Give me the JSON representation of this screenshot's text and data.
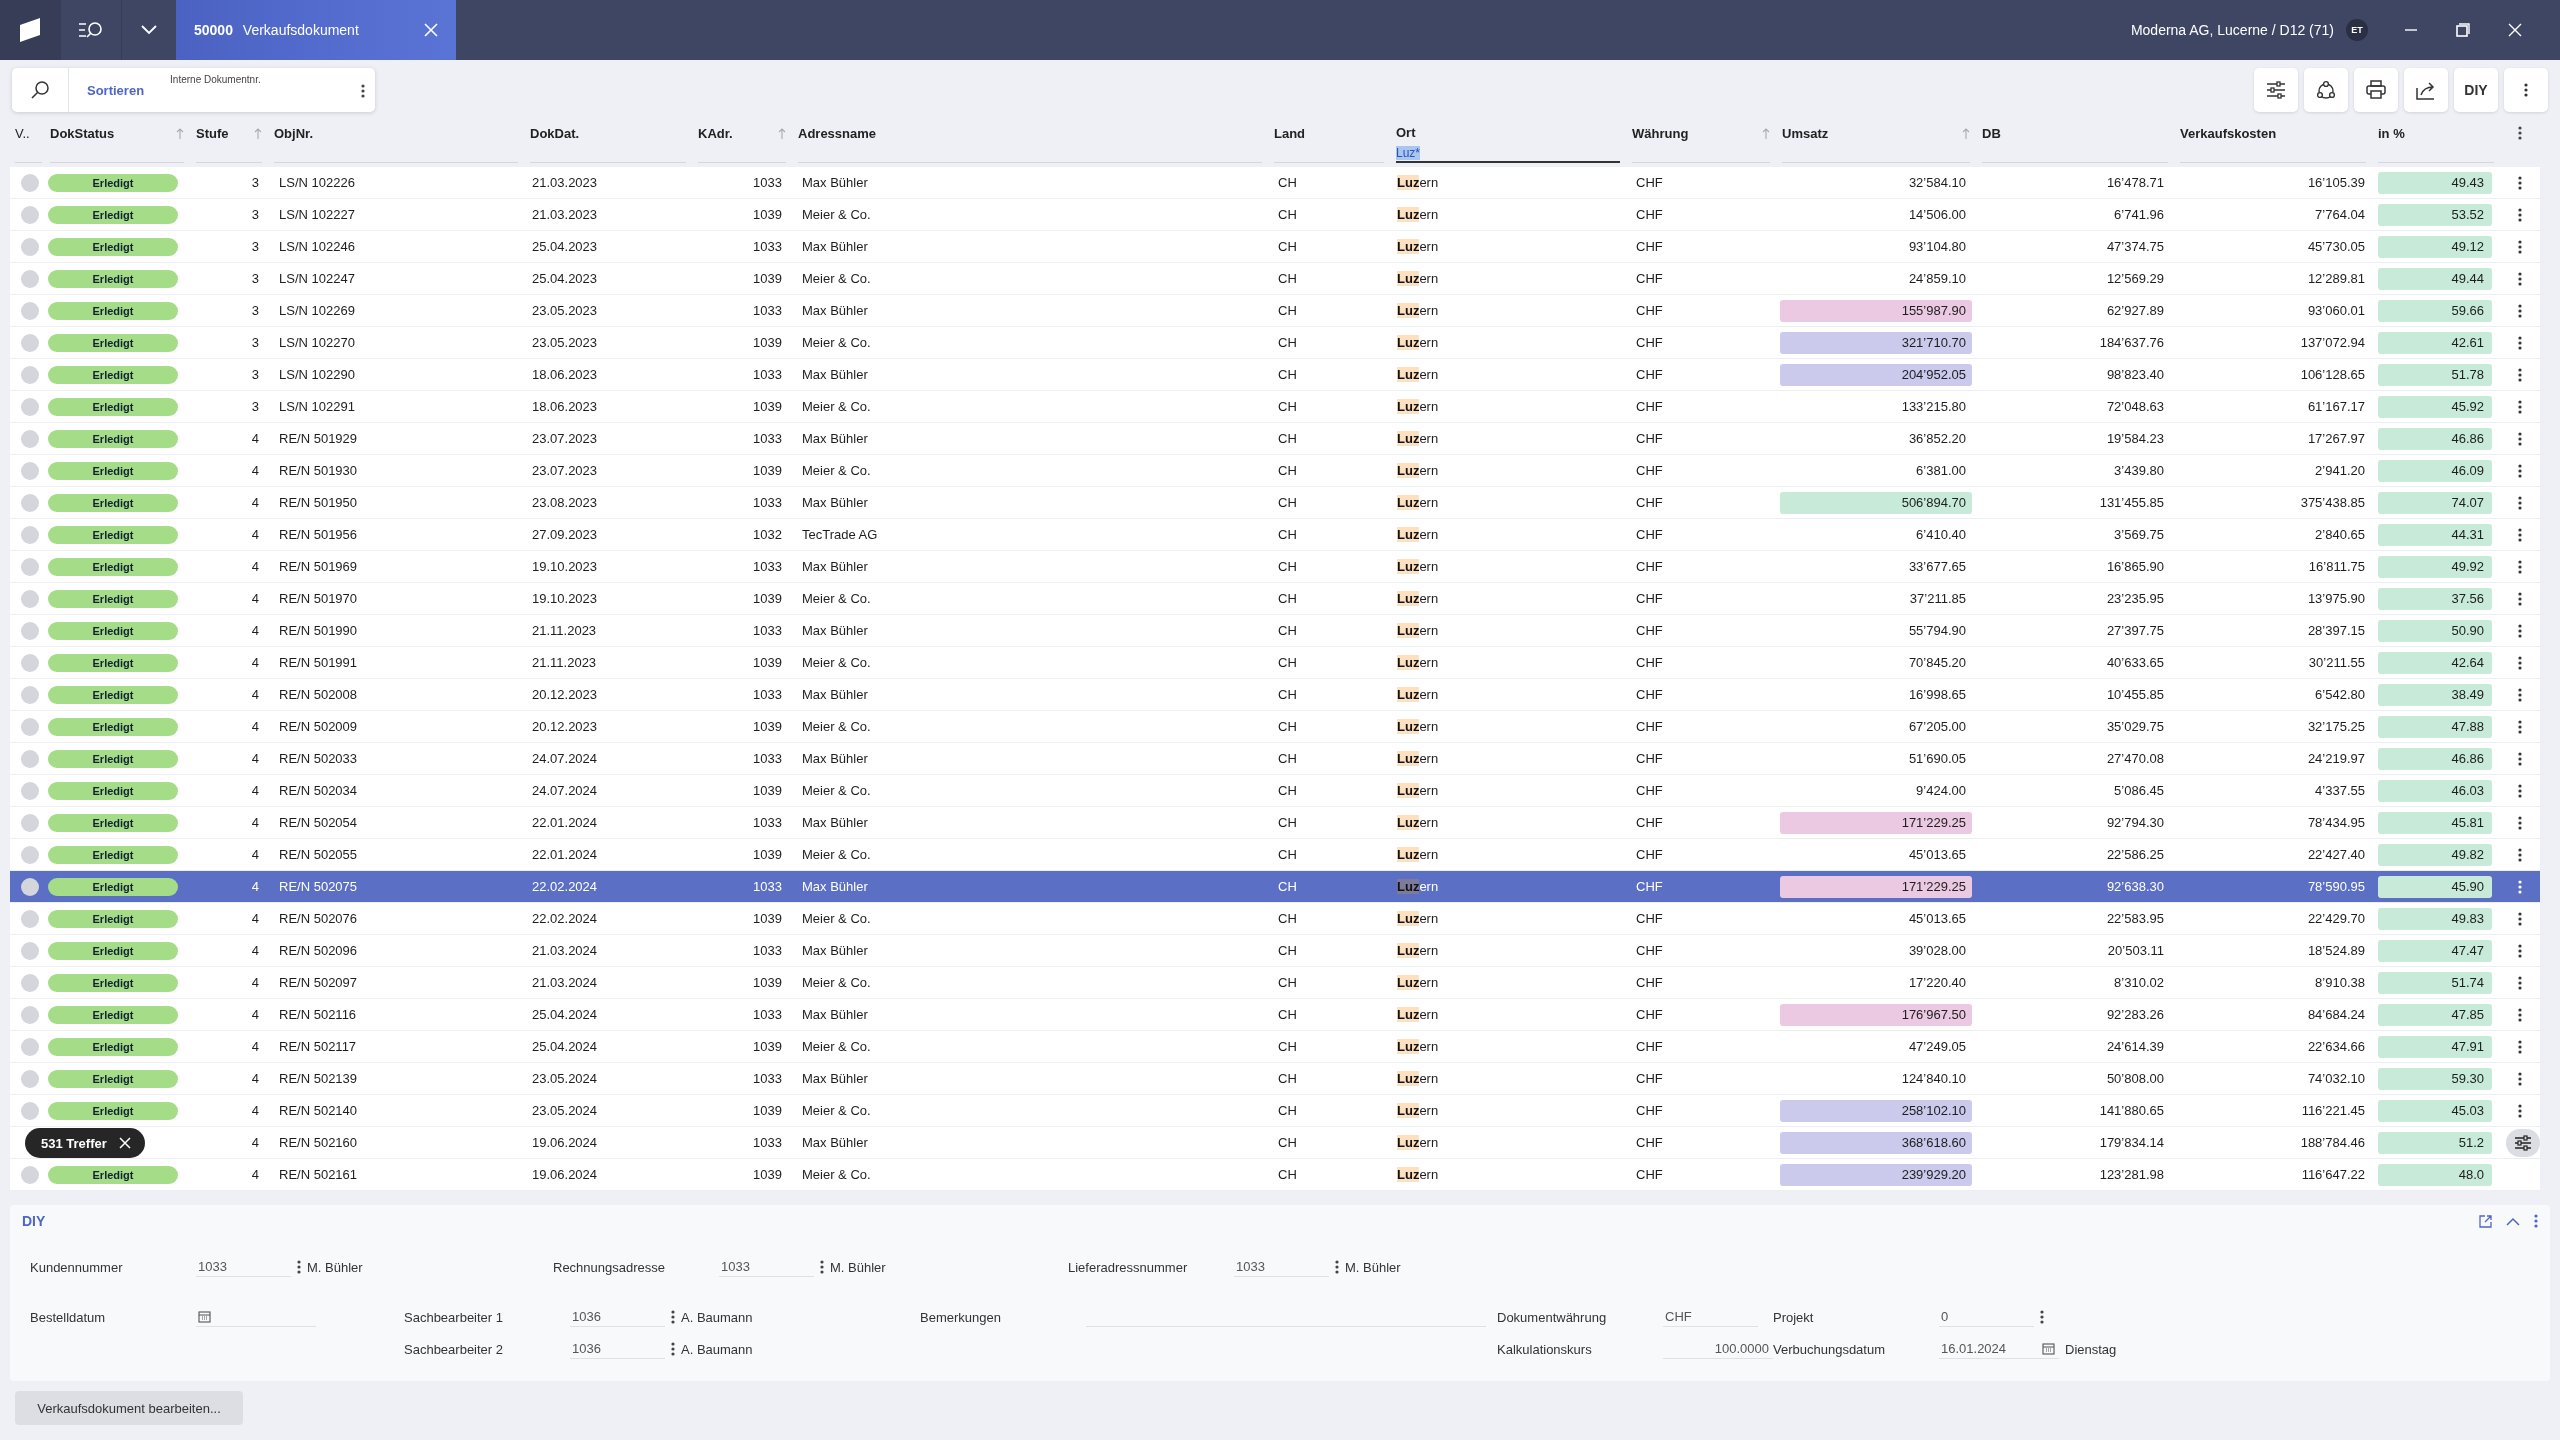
{
  "titlebar": {
    "tab": {
      "number": "50000",
      "title": "Verkaufsdokument",
      "selected": true
    },
    "company": "Moderna AG, Lucerne / D12 (71)",
    "avatar": "ET"
  },
  "search_card": {
    "sort_label": "Sortieren",
    "field_label": "Interne Dokumentnr."
  },
  "toolbar": {
    "diy_label": "DIY"
  },
  "table": {
    "columns": [
      {
        "label": "V..",
        "sortable": false
      },
      {
        "label": "DokStatus",
        "sortable": true
      },
      {
        "label": "Stufe",
        "sortable": true
      },
      {
        "label": "ObjNr.",
        "sortable": false
      },
      {
        "label": "DokDat.",
        "sortable": false
      },
      {
        "label": "KAdr.",
        "sortable": true
      },
      {
        "label": "Adressname",
        "sortable": false
      },
      {
        "label": "Land",
        "sortable": false
      },
      {
        "label": "Ort",
        "sortable": false,
        "filter": "Luz*"
      },
      {
        "label": "Währung",
        "sortable": true
      },
      {
        "label": "Umsatz",
        "sortable": true
      },
      {
        "label": "DB",
        "sortable": false
      },
      {
        "label": "Verkaufskosten",
        "sortable": false
      },
      {
        "label": "in %",
        "sortable": false
      }
    ],
    "rows": [
      {
        "status": "Erledigt",
        "stufe": "3",
        "objnr": "LS/N 102226",
        "dokdat": "21.03.2023",
        "kadr": "1033",
        "adressname": "Max Bühler",
        "land": "CH",
        "ort": "**Luz**ern",
        "waehrung": "CHF",
        "umsatz": "32’584.10",
        "db": "16’478.71",
        "verkaufskosten": "16’105.39",
        "in_pct": "49.43",
        "selected": false
      },
      {
        "status": "Erledigt",
        "stufe": "3",
        "objnr": "LS/N 102227",
        "dokdat": "21.03.2023",
        "kadr": "1039",
        "adressname": "Meier & Co.",
        "land": "CH",
        "ort": "**Luz**ern",
        "waehrung": "CHF",
        "umsatz": "14’506.00",
        "db": "6’741.96",
        "verkaufskosten": "7’764.04",
        "in_pct": "53.52",
        "selected": false
      },
      {
        "status": "Erledigt",
        "stufe": "3",
        "objnr": "LS/N 102246",
        "dokdat": "25.04.2023",
        "kadr": "1033",
        "adressname": "Max Bühler",
        "land": "CH",
        "ort": "**Luz**ern",
        "waehrung": "CHF",
        "umsatz": "93’104.80",
        "db": "47’374.75",
        "verkaufskosten": "45’730.05",
        "in_pct": "49.12",
        "selected": false
      },
      {
        "status": "Erledigt",
        "stufe": "3",
        "objnr": "LS/N 102247",
        "dokdat": "25.04.2023",
        "kadr": "1039",
        "adressname": "Meier & Co.",
        "land": "CH",
        "ort": "**Luz**ern",
        "waehrung": "CHF",
        "umsatz": "24’859.10",
        "db": "12’569.29",
        "verkaufskosten": "12’289.81",
        "in_pct": "49.44",
        "selected": false
      },
      {
        "status": "Erledigt",
        "stufe": "3",
        "objnr": "LS/N 102269",
        "dokdat": "23.05.2023",
        "kadr": "1033",
        "adressname": "Max Bühler",
        "land": "CH",
        "ort": "**Luz**ern",
        "waehrung": "CHF",
        "umsatz": "155’987.90",
        "color": "#ecc9e2",
        "db": "62’927.89",
        "verkaufskosten": "93’060.01",
        "in_pct": "59.66",
        "selected": false
      },
      {
        "status": "Erledigt",
        "stufe": "3",
        "objnr": "LS/N 102270",
        "dokdat": "23.05.2023",
        "kadr": "1039",
        "adressname": "Meier & Co.",
        "land": "CH",
        "ort": "**Luz**ern",
        "waehrung": "CHF",
        "umsatz": "321’710.70",
        "color": "#cbc9ec",
        "db": "184’637.76",
        "verkaufskosten": "137’072.94",
        "in_pct": "42.61",
        "selected": false
      },
      {
        "status": "Erledigt",
        "stufe": "3",
        "objnr": "LS/N 102290",
        "dokdat": "18.06.2023",
        "kadr": "1033",
        "adressname": "Max Bühler",
        "land": "CH",
        "ort": "**Luz**ern",
        "waehrung": "CHF",
        "umsatz": "204’952.05",
        "color": "#cbc9ec",
        "db": "98’823.40",
        "verkaufskosten": "106’128.65",
        "in_pct": "51.78",
        "selected": false
      },
      {
        "status": "Erledigt",
        "stufe": "3",
        "objnr": "LS/N 102291",
        "dokdat": "18.06.2023",
        "kadr": "1039",
        "adressname": "Meier & Co.",
        "land": "CH",
        "ort": "**Luz**ern",
        "waehrung": "CHF",
        "umsatz": "133’215.80",
        "db": "72’048.63",
        "verkaufskosten": "61’167.17",
        "in_pct": "45.92",
        "selected": false
      },
      {
        "status": "Erledigt",
        "stufe": "4",
        "objnr": "RE/N 501929",
        "dokdat": "23.07.2023",
        "kadr": "1033",
        "adressname": "Max Bühler",
        "land": "CH",
        "ort": "**Luz**ern",
        "waehrung": "CHF",
        "umsatz": "36’852.20",
        "db": "19’584.23",
        "verkaufskosten": "17’267.97",
        "in_pct": "46.86",
        "selected": false
      },
      {
        "status": "Erledigt",
        "stufe": "4",
        "objnr": "RE/N 501930",
        "dokdat": "23.07.2023",
        "kadr": "1039",
        "adressname": "Meier & Co.",
        "land": "CH",
        "ort": "**Luz**ern",
        "waehrung": "CHF",
        "umsatz": "6’381.00",
        "db": "3’439.80",
        "verkaufskosten": "2’941.20",
        "in_pct": "46.09",
        "selected": false
      },
      {
        "status": "Erledigt",
        "stufe": "4",
        "objnr": "RE/N 501950",
        "dokdat": "23.08.2023",
        "kadr": "1033",
        "adressname": "Max Bühler",
        "land": "CH",
        "ort": "**Luz**ern",
        "waehrung": "CHF",
        "umsatz": "506’894.70",
        "color": "#c8ead8",
        "db": "131’455.85",
        "verkaufskosten": "375’438.85",
        "in_pct": "74.07",
        "selected": false
      },
      {
        "status": "Erledigt",
        "stufe": "4",
        "objnr": "RE/N 501956",
        "dokdat": "27.09.2023",
        "kadr": "1032",
        "adressname": "TecTrade AG",
        "land": "CH",
        "ort": "**Luz**ern",
        "waehrung": "CHF",
        "umsatz": "6’410.40",
        "db": "3’569.75",
        "verkaufskosten": "2’840.65",
        "in_pct": "44.31",
        "selected": false
      },
      {
        "status": "Erledigt",
        "stufe": "4",
        "objnr": "RE/N 501969",
        "dokdat": "19.10.2023",
        "kadr": "1033",
        "adressname": "Max Bühler",
        "land": "CH",
        "ort": "**Luz**ern",
        "waehrung": "CHF",
        "umsatz": "33’677.65",
        "db": "16’865.90",
        "verkaufskosten": "16’811.75",
        "in_pct": "49.92",
        "selected": false
      },
      {
        "status": "Erledigt",
        "stufe": "4",
        "objnr": "RE/N 501970",
        "dokdat": "19.10.2023",
        "kadr": "1039",
        "adressname": "Meier & Co.",
        "land": "CH",
        "ort": "**Luz**ern",
        "waehrung": "CHF",
        "umsatz": "37’211.85",
        "db": "23’235.95",
        "verkaufskosten": "13’975.90",
        "in_pct": "37.56",
        "selected": false
      },
      {
        "status": "Erledigt",
        "stufe": "4",
        "objnr": "RE/N 501990",
        "dokdat": "21.11.2023",
        "kadr": "1033",
        "adressname": "Max Bühler",
        "land": "CH",
        "ort": "**Luz**ern",
        "waehrung": "CHF",
        "umsatz": "55’794.90",
        "db": "27’397.75",
        "verkaufskosten": "28’397.15",
        "in_pct": "50.90",
        "selected": false
      },
      {
        "status": "Erledigt",
        "stufe": "4",
        "objnr": "RE/N 501991",
        "dokdat": "21.11.2023",
        "kadr": "1039",
        "adressname": "Meier & Co.",
        "land": "CH",
        "ort": "**Luz**ern",
        "waehrung": "CHF",
        "umsatz": "70’845.20",
        "db": "40’633.65",
        "verkaufskosten": "30’211.55",
        "in_pct": "42.64",
        "selected": false
      },
      {
        "status": "Erledigt",
        "stufe": "4",
        "objnr": "RE/N 502008",
        "dokdat": "20.12.2023",
        "kadr": "1033",
        "adressname": "Max Bühler",
        "land": "CH",
        "ort": "**Luz**ern",
        "waehrung": "CHF",
        "umsatz": "16’998.65",
        "db": "10’455.85",
        "verkaufskosten": "6’542.80",
        "in_pct": "38.49",
        "selected": false
      },
      {
        "status": "Erledigt",
        "stufe": "4",
        "objnr": "RE/N 502009",
        "dokdat": "20.12.2023",
        "kadr": "1039",
        "adressname": "Meier & Co.",
        "land": "CH",
        "ort": "**Luz**ern",
        "waehrung": "CHF",
        "umsatz": "67’205.00",
        "db": "35’029.75",
        "verkaufskosten": "32’175.25",
        "in_pct": "47.88",
        "selected": false
      },
      {
        "status": "Erledigt",
        "stufe": "4",
        "objnr": "RE/N 502033",
        "dokdat": "24.07.2024",
        "kadr": "1033",
        "adressname": "Max Bühler",
        "land": "CH",
        "ort": "**Luz**ern",
        "waehrung": "CHF",
        "umsatz": "51’690.05",
        "db": "27’470.08",
        "verkaufskosten": "24’219.97",
        "in_pct": "46.86",
        "selected": false
      },
      {
        "status": "Erledigt",
        "stufe": "4",
        "objnr": "RE/N 502034",
        "dokdat": "24.07.2024",
        "kadr": "1039",
        "adressname": "Meier & Co.",
        "land": "CH",
        "ort": "**Luz**ern",
        "waehrung": "CHF",
        "umsatz": "9’424.00",
        "db": "5’086.45",
        "verkaufskosten": "4’337.55",
        "in_pct": "46.03",
        "selected": false
      },
      {
        "status": "Erledigt",
        "stufe": "4",
        "objnr": "RE/N 502054",
        "dokdat": "22.01.2024",
        "kadr": "1033",
        "adressname": "Max Bühler",
        "land": "CH",
        "ort": "**Luz**ern",
        "waehrung": "CHF",
        "umsatz": "171’229.25",
        "color": "#ecc9e2",
        "db": "92’794.30",
        "verkaufskosten": "78’434.95",
        "in_pct": "45.81",
        "selected": false
      },
      {
        "status": "Erledigt",
        "stufe": "4",
        "objnr": "RE/N 502055",
        "dokdat": "22.01.2024",
        "kadr": "1039",
        "adressname": "Meier & Co.",
        "land": "CH",
        "ort": "**Luz**ern",
        "waehrung": "CHF",
        "umsatz": "45’013.65",
        "db": "22’586.25",
        "verkaufskosten": "22’427.40",
        "in_pct": "49.82",
        "selected": false
      },
      {
        "status": "Erledigt",
        "stufe": "4",
        "objnr": "RE/N 502075",
        "dokdat": "22.02.2024",
        "kadr": "1033",
        "adressname": "Max Bühler",
        "land": "CH",
        "ort": "**Luz**ern",
        "waehrung": "CHF",
        "umsatz": "171’229.25",
        "color": "#ecc9e2",
        "db": "92’638.30",
        "verkaufskosten": "78’590.95",
        "in_pct": "45.90",
        "selected": true
      },
      {
        "status": "Erledigt",
        "stufe": "4",
        "objnr": "RE/N 502076",
        "dokdat": "22.02.2024",
        "kadr": "1039",
        "adressname": "Meier & Co.",
        "land": "CH",
        "ort": "**Luz**ern",
        "waehrung": "CHF",
        "umsatz": "45’013.65",
        "db": "22’583.95",
        "verkaufskosten": "22’429.70",
        "in_pct": "49.83",
        "selected": false
      },
      {
        "status": "Erledigt",
        "stufe": "4",
        "objnr": "RE/N 502096",
        "dokdat": "21.03.2024",
        "kadr": "1033",
        "adressname": "Max Bühler",
        "land": "CH",
        "ort": "**Luz**ern",
        "waehrung": "CHF",
        "umsatz": "39’028.00",
        "db": "20’503.11",
        "verkaufskosten": "18’524.89",
        "in_pct": "47.47",
        "selected": false
      },
      {
        "status": "Erledigt",
        "stufe": "4",
        "objnr": "RE/N 502097",
        "dokdat": "21.03.2024",
        "kadr": "1039",
        "adressname": "Meier & Co.",
        "land": "CH",
        "ort": "**Luz**ern",
        "waehrung": "CHF",
        "umsatz": "17’220.40",
        "db": "8’310.02",
        "verkaufskosten": "8’910.38",
        "in_pct": "51.74",
        "selected": false
      },
      {
        "status": "Erledigt",
        "stufe": "4",
        "objnr": "RE/N 502116",
        "dokdat": "25.04.2024",
        "kadr": "1033",
        "adressname": "Max Bühler",
        "land": "CH",
        "ort": "**Luz**ern",
        "waehrung": "CHF",
        "umsatz": "176’967.50",
        "color": "#ecc9e2",
        "db": "92’283.26",
        "verkaufskosten": "84’684.24",
        "in_pct": "47.85",
        "selected": false
      },
      {
        "status": "Erledigt",
        "stufe": "4",
        "objnr": "RE/N 502117",
        "dokdat": "25.04.2024",
        "kadr": "1039",
        "adressname": "Meier & Co.",
        "land": "CH",
        "ort": "**Luz**ern",
        "waehrung": "CHF",
        "umsatz": "47’249.05",
        "db": "24’614.39",
        "verkaufskosten": "22’634.66",
        "in_pct": "47.91",
        "selected": false
      },
      {
        "status": "Erledigt",
        "stufe": "4",
        "objnr": "RE/N 502139",
        "dokdat": "23.05.2024",
        "kadr": "1033",
        "adressname": "Max Bühler",
        "land": "CH",
        "ort": "**Luz**ern",
        "waehrung": "CHF",
        "umsatz": "124’840.10",
        "db": "50’808.00",
        "verkaufskosten": "74’032.10",
        "in_pct": "59.30",
        "selected": false
      },
      {
        "status": "Erledigt",
        "stufe": "4",
        "objnr": "RE/N 502140",
        "dokdat": "23.05.2024",
        "kadr": "1039",
        "adressname": "Meier & Co.",
        "land": "CH",
        "ort": "**Luz**ern",
        "waehrung": "CHF",
        "umsatz": "258’102.10",
        "color": "#cbc9ec",
        "db": "141’880.65",
        "verkaufskosten": "116’221.45",
        "in_pct": "45.03",
        "selected": false
      },
      {
        "stufe": "4",
        "objnr": "RE/N 502160",
        "dokdat": "19.06.2024",
        "kadr": "1033",
        "adressname": "Max Bühler",
        "land": "CH",
        "ort": "**Luz**ern",
        "waehrung": "CHF",
        "umsatz": "368’618.60",
        "color": "#cbc9ec",
        "db": "179’834.14",
        "verkaufskosten": "188’784.46",
        "in_pct": "51.2",
        "selected": false
      },
      {
        "status": "Erledigt",
        "stufe": "4",
        "objnr": "RE/N 502161",
        "dokdat": "19.06.2024",
        "kadr": "1039",
        "adressname": "Meier & Co.",
        "land": "CH",
        "ort": "**Luz**ern",
        "waehrung": "CHF",
        "umsatz": "239’929.20",
        "color": "#cbc9ec",
        "db": "123’281.98",
        "verkaufskosten": "116’647.22",
        "in_pct": "48.0",
        "selected": false
      }
    ]
  },
  "results_chip": "531 Treffer",
  "detail_panel": {
    "logo": "DIY",
    "fields": [
      {
        "kind": "lookup",
        "label": "Kundennummer",
        "value": "1033",
        "name": "M. Bühler"
      },
      {
        "kind": "lookup",
        "label": "Rechnungsadresse",
        "value": "1033",
        "name": "M. Bühler"
      },
      {
        "kind": "lookup",
        "label": "Lieferadressnummer",
        "value": "1033",
        "name": "M. Bühler"
      },
      {
        "kind": "date",
        "label": "Bestelldatum"
      },
      {
        "kind": "lookup",
        "label": "Sachbearbeiter 1",
        "value": "1036",
        "name": "A. Baumann"
      },
      {
        "kind": "memo",
        "label": "Bemerkungen"
      },
      {
        "kind": "plain",
        "label": "Dokumentwährung",
        "value": "CHF"
      },
      {
        "kind": "lookup",
        "label": "Projekt",
        "value": "0"
      },
      {
        "kind": "lookup",
        "label": "Sachbearbeiter 2",
        "value": "1036",
        "name": "A. Baumann"
      },
      {
        "kind": "number",
        "label": "Kalkulationskurs",
        "value": "100.0000"
      },
      {
        "kind": "date",
        "label": "Verbuchungsdatum",
        "value": "16.01.2024",
        "weekday": "Dienstag"
      }
    ]
  },
  "edit_button": "Verkaufsdokument bearbeiten..."
}
